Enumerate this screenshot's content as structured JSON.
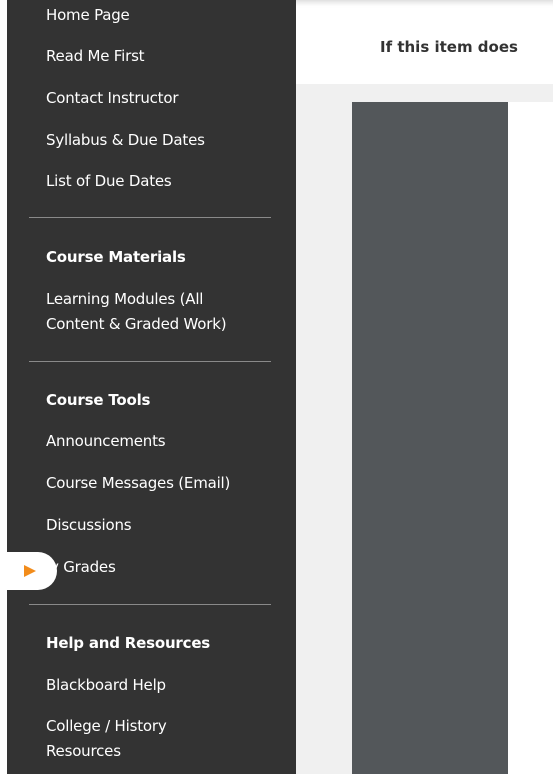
{
  "sidebar": {
    "items": [
      {
        "label": "Home Page"
      },
      {
        "label": "Read Me First"
      },
      {
        "label": "Contact Instructor"
      },
      {
        "label": "Syllabus & Due Dates"
      },
      {
        "label": "List of Due Dates"
      }
    ],
    "course_materials": {
      "heading": "Course Materials",
      "item_line1": "Learning Modules (All",
      "item_line2": "Content & Graded Work)"
    },
    "course_tools": {
      "heading": "Course Tools",
      "items": [
        {
          "label": "Announcements"
        },
        {
          "label": "Course Messages (Email)"
        },
        {
          "label": "Discussions"
        },
        {
          "label": "ly Grades"
        }
      ]
    },
    "help_resources": {
      "heading": "Help and Resources",
      "item1": "Blackboard Help",
      "item2_line1": "College / History",
      "item2_line2": "Resources"
    }
  },
  "main": {
    "notice": "If this item does"
  },
  "colors": {
    "sidebar_bg": "#333333",
    "toggle_arrow": "#f28c1b",
    "viewer_panel": "#53575a"
  }
}
